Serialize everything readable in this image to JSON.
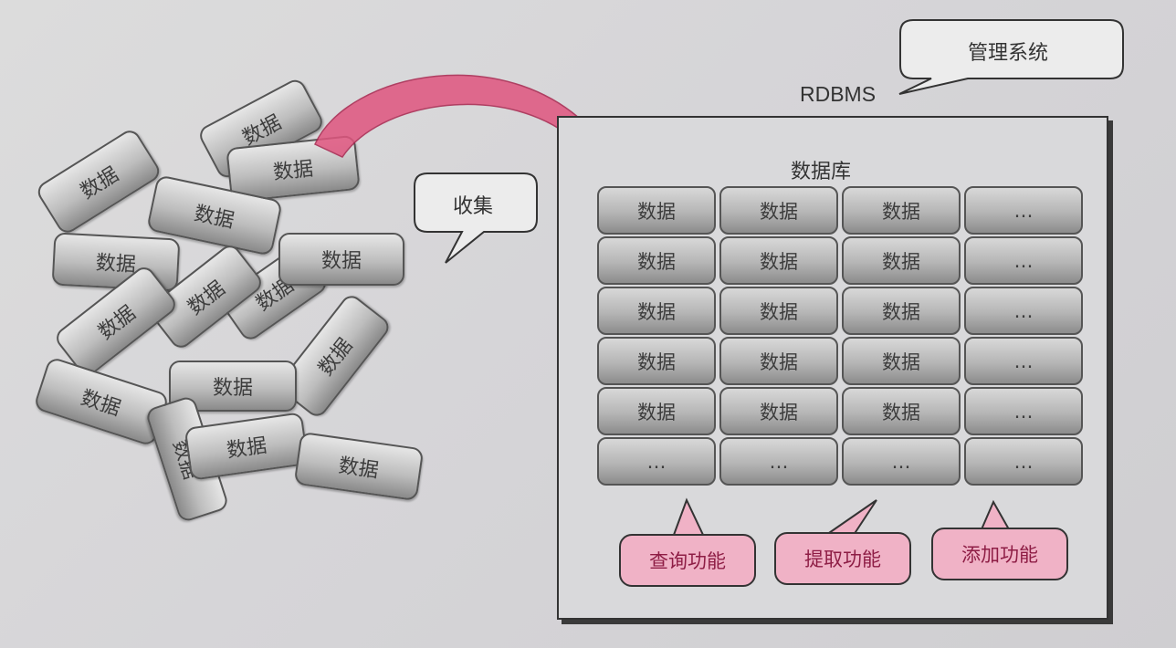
{
  "scattered_label": "数据",
  "collect_bubble": "收集",
  "rdbms_label": "RDBMS",
  "mgmt_bubble": "管理系统",
  "db_title": "数据库",
  "table_rows": [
    [
      "数据",
      "数据",
      "数据",
      "…"
    ],
    [
      "数据",
      "数据",
      "数据",
      "…"
    ],
    [
      "数据",
      "数据",
      "数据",
      "…"
    ],
    [
      "数据",
      "数据",
      "数据",
      "…"
    ],
    [
      "数据",
      "数据",
      "数据",
      "…"
    ],
    [
      "…",
      "…",
      "…",
      "…"
    ]
  ],
  "functions": [
    "查询功能",
    "提取功能",
    "添加功能"
  ],
  "colors": {
    "accent_pink": "#e0557f",
    "function_fill": "#f0b2c6",
    "function_text": "#8e1d45"
  }
}
